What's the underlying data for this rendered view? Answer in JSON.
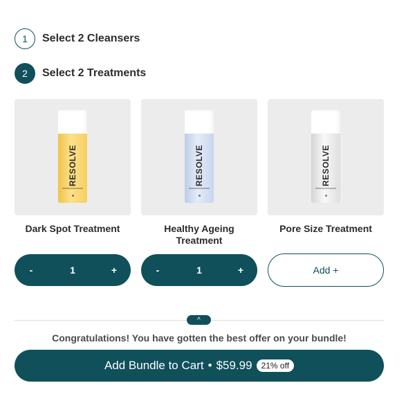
{
  "steps": [
    {
      "number": "1",
      "title": "Select 2 Cleansers"
    },
    {
      "number": "2",
      "title": "Select 2 Treatments"
    }
  ],
  "products": [
    {
      "name": "Dark Spot Treatment",
      "brand": "RESOLVE",
      "color": "#f5cf62",
      "quantity": {
        "minus": "-",
        "value": "1",
        "plus": "+"
      }
    },
    {
      "name": "Healthy Ageing Treatment",
      "brand": "RESOLVE",
      "color": "#d6e1f3",
      "quantity": {
        "minus": "-",
        "value": "1",
        "plus": "+"
      }
    },
    {
      "name": "Pore Size Treatment",
      "brand": "RESOLVE",
      "color": "#ececec",
      "add_label": "Add +"
    }
  ],
  "toggle_icon": "^",
  "offer_message": "Congratulations! You have gotten the best offer on your bundle!",
  "cart_button": {
    "label": "Add Bundle to Cart",
    "separator": "•",
    "price": "$59.99",
    "discount": "21% off"
  },
  "colors": {
    "primary": "#0f505b",
    "card_bg": "#ececec"
  }
}
